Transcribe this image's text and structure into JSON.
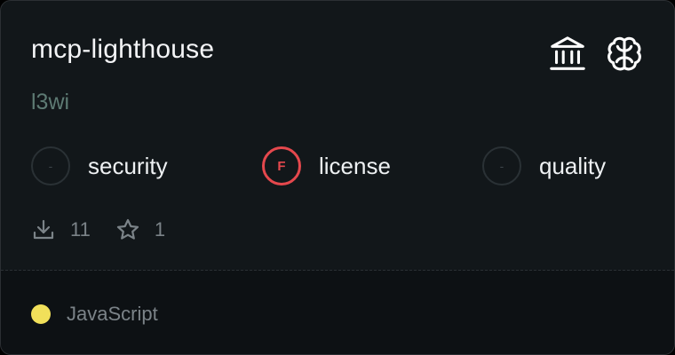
{
  "server": {
    "name": "mcp-lighthouse",
    "author": "l3wi"
  },
  "header_icons": [
    {
      "icon": "bank-icon"
    },
    {
      "icon": "brain-icon"
    }
  ],
  "scores": [
    {
      "grade": "-",
      "label": "security",
      "status": "none"
    },
    {
      "grade": "F",
      "label": "license",
      "status": "fail"
    },
    {
      "grade": "-",
      "label": "quality",
      "status": "none"
    }
  ],
  "stats": {
    "downloads": "11",
    "stars": "1"
  },
  "footer": {
    "language": "JavaScript",
    "language_color": "#f1e05a"
  },
  "colors": {
    "card_bg": "#12171a",
    "footer_bg": "#0d1114",
    "fail_red": "#e5484d",
    "author_green": "#5d7a73"
  }
}
